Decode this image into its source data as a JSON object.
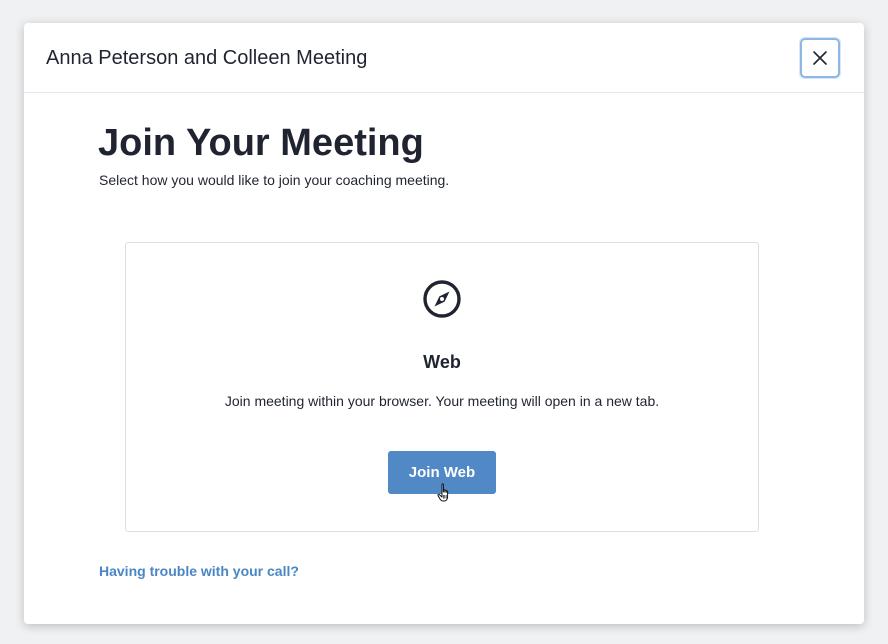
{
  "modal": {
    "title": "Anna Peterson and Colleen Meeting",
    "close_icon": "close-icon"
  },
  "main": {
    "heading": "Join Your Meeting",
    "subheading": "Select how you would like to join your coaching meeting."
  },
  "card": {
    "icon": "compass-icon",
    "title": "Web",
    "description": "Join meeting within your browser. Your meeting will open in a new tab.",
    "button_label": "Join Web"
  },
  "footer": {
    "trouble_link": "Having trouble with your call?"
  },
  "colors": {
    "primary_button": "#5189c6",
    "link": "#4a86c5",
    "text": "#1f2430",
    "focus_ring": "#8db8e6"
  }
}
